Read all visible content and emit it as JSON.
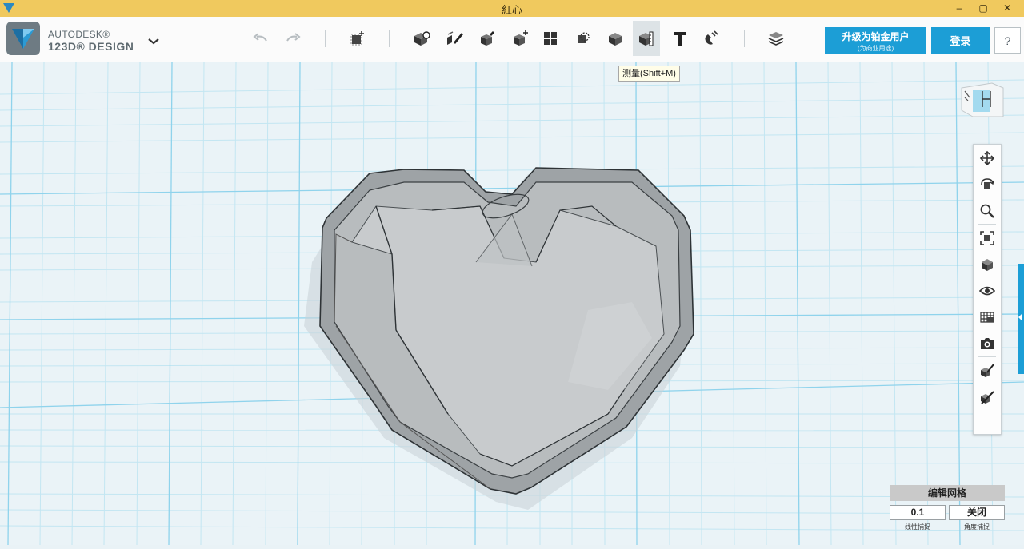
{
  "window": {
    "title": "紅心",
    "minimize_glyph": "–",
    "maximize_glyph": "▢",
    "close_glyph": "✕"
  },
  "brand": {
    "line1": "AUTODESK®",
    "line2": "123D® DESIGN",
    "icon": "autodesk-logo-icon"
  },
  "toolbar": {
    "tools": [
      {
        "name": "undo",
        "icon": "undo-icon"
      },
      {
        "name": "redo",
        "icon": "redo-icon"
      },
      {
        "name": "transform",
        "icon": "transform-icon"
      },
      {
        "name": "primitives",
        "icon": "primitives-icon"
      },
      {
        "name": "sketch",
        "icon": "sketch-icon"
      },
      {
        "name": "construct",
        "icon": "construct-icon"
      },
      {
        "name": "modify",
        "icon": "modify-icon"
      },
      {
        "name": "pattern",
        "icon": "pattern-icon"
      },
      {
        "name": "grouping",
        "icon": "grouping-icon"
      },
      {
        "name": "combine",
        "icon": "combine-icon"
      },
      {
        "name": "measure",
        "icon": "measure-icon",
        "active": true
      },
      {
        "name": "text",
        "icon": "text-icon"
      },
      {
        "name": "snap",
        "icon": "snap-icon"
      },
      {
        "name": "materials",
        "icon": "materials-icon"
      }
    ],
    "upgrade_label": "升级为铂金用户",
    "upgrade_sublabel": "(为商业用途)",
    "login_label": "登录",
    "help_label": "?"
  },
  "tooltip": {
    "text": "测量(Shift+M)"
  },
  "navbar": {
    "items": [
      "pan-icon",
      "orbit-icon",
      "zoom-icon",
      "fit-icon",
      "view-cube-icon",
      "visibility-icon",
      "grid-material-icon",
      "screenshot-icon",
      "edit-object-icon",
      "hide-object-icon"
    ]
  },
  "grid_panel": {
    "header": "编辑网格",
    "linear_snap_value": "0.1",
    "angle_snap_value": "关闭",
    "linear_snap_label": "线性捕捉",
    "angle_snap_label": "角度捕捉"
  },
  "colors": {
    "titlebar": "#f0c95e",
    "accent": "#1c9ed6",
    "grid_bg": "#e9f2f6",
    "grid_major": "#8fd3ec",
    "grid_minor": "#b9e2f0",
    "model_fill": "#a9adb0"
  }
}
